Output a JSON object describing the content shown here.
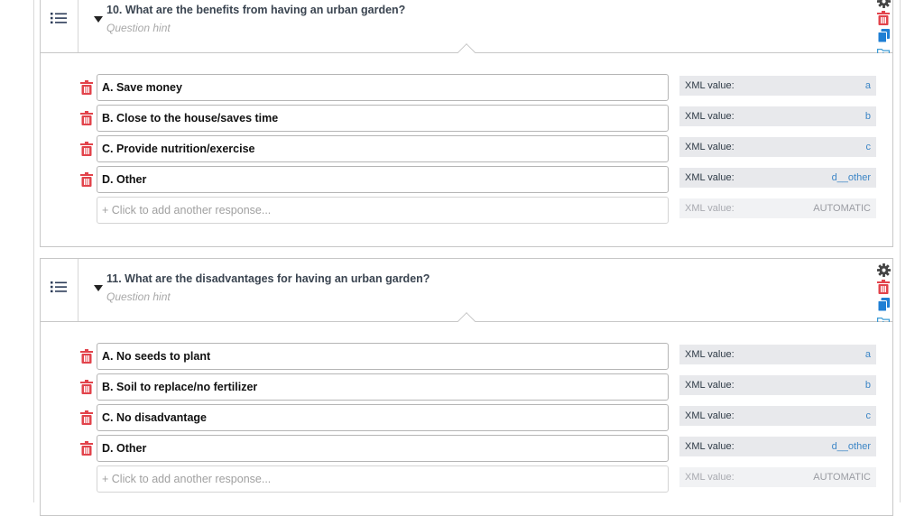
{
  "colors": {
    "accent": "#3d86c6",
    "danger": "#e2434b",
    "text": "#3a4450",
    "hint": "#a8a8a8"
  },
  "xml_label": "XML value:",
  "questions": [
    {
      "label": "10. What are the benefits from having an urban garden?",
      "hint": "Question hint",
      "choices": [
        {
          "label": "A. Save money",
          "value": "a"
        },
        {
          "label": "B. Close to the house/saves time",
          "value": "b"
        },
        {
          "label": "C. Provide nutrition/exercise",
          "value": "c"
        },
        {
          "label": "D. Other",
          "value": "d__other"
        }
      ],
      "add_placeholder": "+ Click to add another response...",
      "add_value": "AUTOMATIC"
    },
    {
      "label": "11. What are the disadvantages for having an urban garden?",
      "hint": "Question hint",
      "choices": [
        {
          "label": "A. No seeds to plant",
          "value": "a"
        },
        {
          "label": "B. Soil to replace/no fertilizer",
          "value": "b"
        },
        {
          "label": "C. No disadvantage",
          "value": "c"
        },
        {
          "label": "D. Other",
          "value": "d__other"
        }
      ],
      "add_placeholder": "+ Click to add another response...",
      "add_value": "AUTOMATIC"
    }
  ]
}
